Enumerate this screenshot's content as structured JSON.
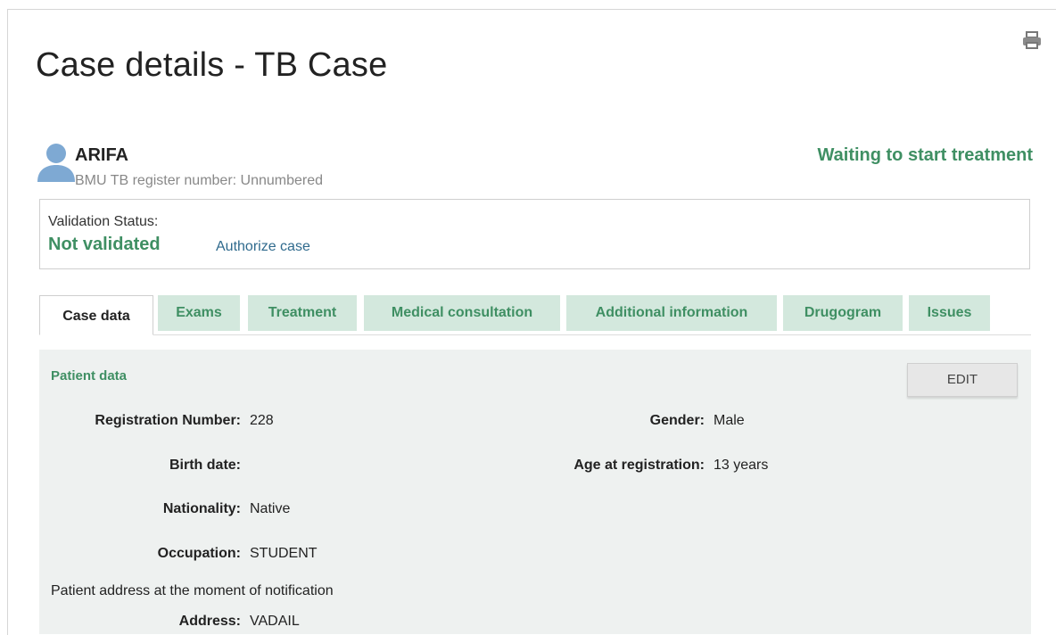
{
  "page": {
    "title": "Case details - TB Case"
  },
  "patient": {
    "name": "ARIFA",
    "register_line": "BMU TB register number: Unnumbered",
    "state": "Waiting to start treatment"
  },
  "validation": {
    "label": "Validation Status:",
    "value": "Not validated",
    "action_link": "Authorize case"
  },
  "tabs": [
    {
      "label": "Case data",
      "active": true
    },
    {
      "label": "Exams"
    },
    {
      "label": "Treatment"
    },
    {
      "label": "Medical consultation"
    },
    {
      "label": "Additional information"
    },
    {
      "label": "Drugogram"
    },
    {
      "label": "Issues"
    }
  ],
  "panel": {
    "section_title": "Patient data",
    "edit_label": "EDIT",
    "fields": {
      "registration_number": {
        "label": "Registration Number:",
        "value": "228"
      },
      "gender": {
        "label": "Gender:",
        "value": "Male"
      },
      "birth_date": {
        "label": "Birth date:",
        "value": ""
      },
      "age": {
        "label": "Age at registration:",
        "value": "13 years"
      },
      "nationality": {
        "label": "Nationality:",
        "value": "Native"
      },
      "occupation": {
        "label": "Occupation:",
        "value": "STUDENT"
      },
      "address": {
        "label": "Address:",
        "value": "VADAIL"
      }
    },
    "address_heading": "Patient address at the moment of notification"
  },
  "colors": {
    "accent_green": "#3f8f63",
    "tab_bg": "#d3e8dd",
    "panel_bg": "#eef1f0",
    "link": "#2f6a8d"
  },
  "icons": {
    "print": "print-icon",
    "avatar": "user-avatar-icon"
  }
}
